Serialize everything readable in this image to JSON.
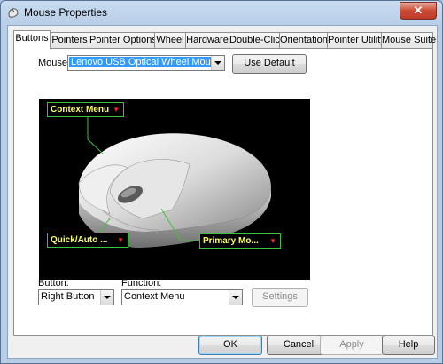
{
  "window": {
    "title": "Mouse Properties",
    "close_glyph": "✕"
  },
  "tabs": [
    {
      "label": "Buttons",
      "active": true
    },
    {
      "label": "Pointers"
    },
    {
      "label": "Pointer Options"
    },
    {
      "label": "Wheel"
    },
    {
      "label": "Hardware"
    },
    {
      "label": "Double-Click"
    },
    {
      "label": "Orientation"
    },
    {
      "label": "Pointer Utility"
    },
    {
      "label": "Mouse Suite"
    }
  ],
  "mouse_select": {
    "label": "Mouse:",
    "value": "Lenovo USB Optical Wheel Mouse"
  },
  "use_default_label": "Use Default",
  "callouts": {
    "top": "Context Menu",
    "left": "Quick/Auto ...",
    "right": "Primary Mo..."
  },
  "button_select": {
    "label": "Button:",
    "value": "Right Button"
  },
  "function_select": {
    "label": "Function:",
    "value": "Context Menu"
  },
  "settings_label": "Settings",
  "footer": {
    "ok": "OK",
    "cancel": "Cancel",
    "apply": "Apply",
    "help": "Help"
  },
  "colors": {
    "callout_border": "#3cc23c",
    "callout_text": "#ffff66",
    "selection": "#3399ff"
  }
}
